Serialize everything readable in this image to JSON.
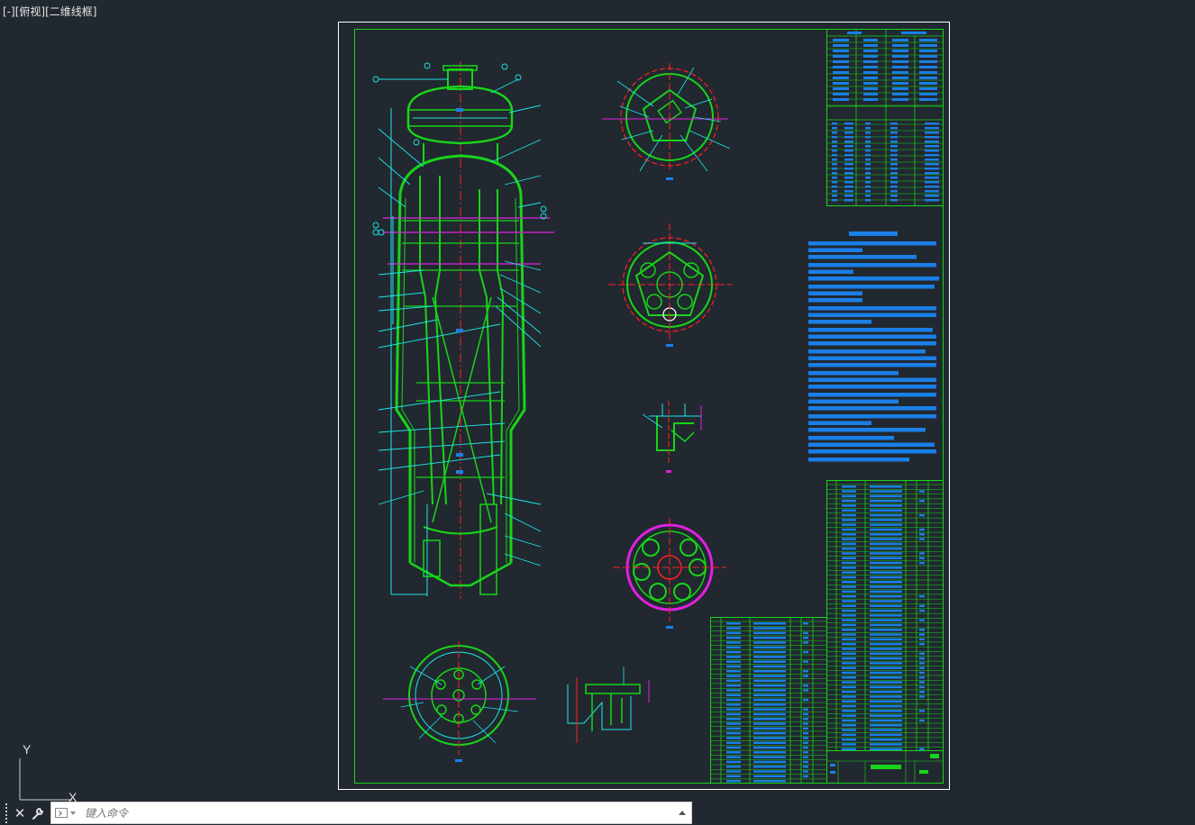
{
  "viewport": {
    "controls": [
      "[-]",
      "[俯视]",
      "[二维线框]"
    ]
  },
  "ucs": {
    "y_label": "Y",
    "x_label": "X"
  },
  "command_line": {
    "placeholder": "键入命令"
  },
  "colors": {
    "background": "#212830",
    "sheet_border": "#ffffff",
    "frame": "#19d419",
    "cyan": "#1ee6e6",
    "red": "#ff2020",
    "magenta": "#e020e0",
    "blue_text": "#1a7fe6",
    "green": "#22dd22"
  },
  "icons": [
    "grip-icon",
    "close-icon",
    "wrench-icon",
    "command-prompt-icon",
    "dropdown-icon",
    "up-arrow-icon",
    "ucs-icon"
  ]
}
